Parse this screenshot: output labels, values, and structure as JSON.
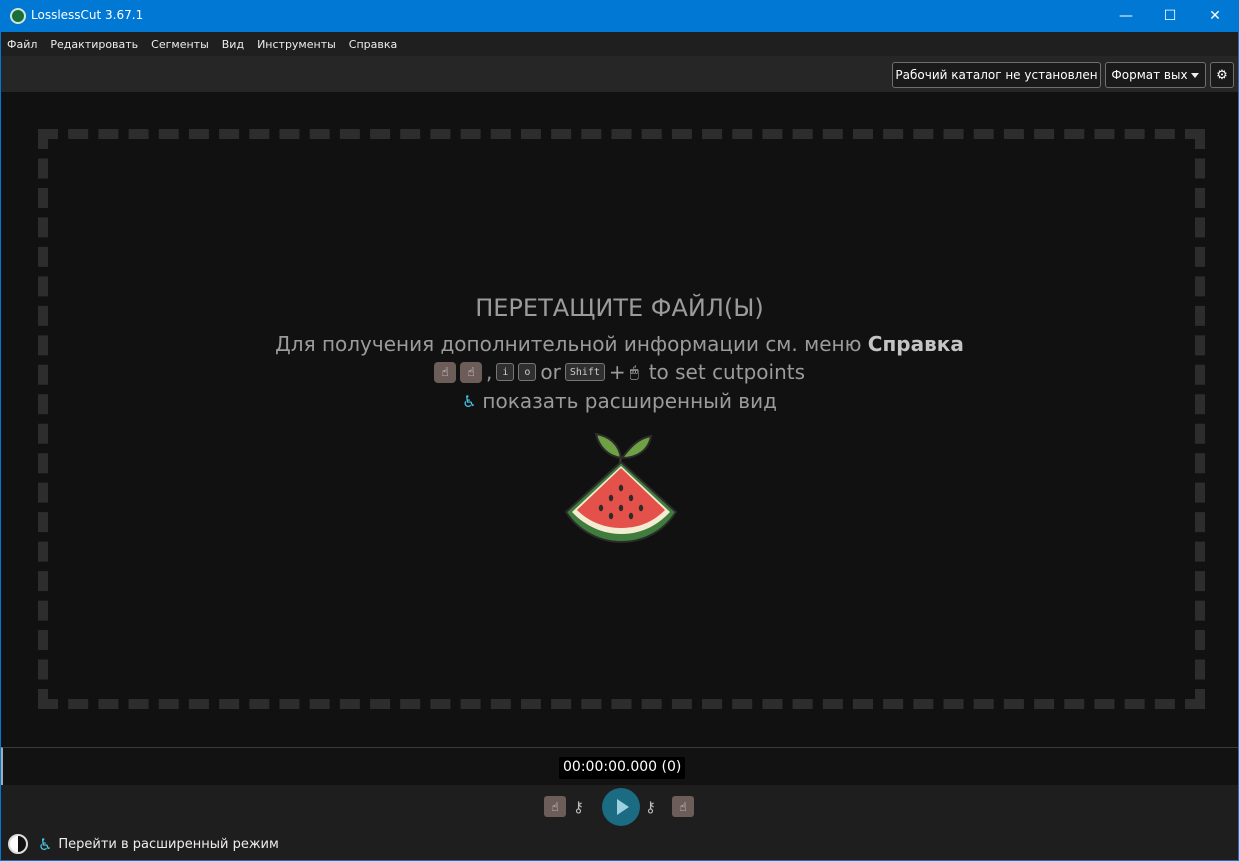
{
  "window": {
    "title": "LosslessCut 3.67.1",
    "minimize_glyph": "—",
    "maximize_glyph": "☐",
    "close_glyph": "✕"
  },
  "menu": [
    "Файл",
    "Редактировать",
    "Сегменты",
    "Вид",
    "Инструменты",
    "Справка"
  ],
  "topbar": {
    "workdir": "Рабочий каталог не установлен",
    "format": "Формат вых",
    "settings_icon": "gear-icon",
    "settings_glyph": "⚙"
  },
  "dropzone": {
    "title": "ПЕРЕТАЩИТЕ ФАЙЛ(Ы)",
    "help_prefix": "Для получения дополнительной информации см. меню",
    "help_bold": "Справка",
    "cut_keys": {
      "comma": ",",
      "key_i": "i",
      "key_o": "o",
      "or": "or",
      "shift": "Shift",
      "plus": "+",
      "tail": "to set cutpoints"
    },
    "advanced_text": "показать расширенный вид"
  },
  "timeline": {
    "time": "00:00:00.000 (0)"
  },
  "bottom": {
    "advanced_link": "Перейти в расширенный режим"
  },
  "icons": {
    "hand_left": "☝",
    "hand_right": "☝",
    "key": "⚷",
    "mouse": "🖱",
    "baby": "♿"
  },
  "colors": {
    "titlebar": "#0078d4",
    "background": "#111111",
    "play_button": "#1b6b82",
    "hand_button": "#6d5d59",
    "baby_icon": "#4cc7e8"
  }
}
